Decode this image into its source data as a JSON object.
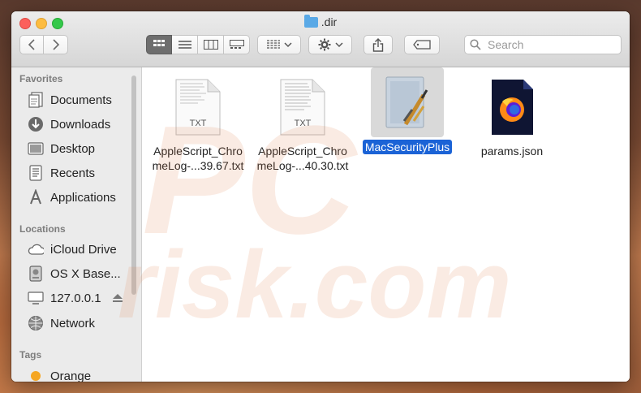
{
  "window": {
    "title": ".dir"
  },
  "toolbar": {
    "back_icon": "chevron-left-icon",
    "forward_icon": "chevron-right-icon",
    "view_modes": [
      "icon-view",
      "list-view",
      "column-view",
      "gallery-view"
    ],
    "active_view": "icon-view",
    "search_placeholder": "Search"
  },
  "sidebar": {
    "favorites_label": "Favorites",
    "favorites": [
      {
        "label": "Documents",
        "icon": "documents-icon"
      },
      {
        "label": "Downloads",
        "icon": "downloads-icon"
      },
      {
        "label": "Desktop",
        "icon": "desktop-icon"
      },
      {
        "label": "Recents",
        "icon": "recents-icon"
      },
      {
        "label": "Applications",
        "icon": "applications-icon"
      }
    ],
    "locations_label": "Locations",
    "locations": [
      {
        "label": "iCloud Drive",
        "icon": "cloud-icon"
      },
      {
        "label": "OS X Base...",
        "icon": "disk-icon"
      },
      {
        "label": "127.0.0.1",
        "icon": "computer-icon",
        "eject_icon": "eject-icon"
      },
      {
        "label": "Network",
        "icon": "network-icon"
      }
    ],
    "tags_label": "Tags",
    "tags": [
      {
        "label": "Orange",
        "color": "#f5a623"
      }
    ]
  },
  "files": [
    {
      "line1": "AppleScript_Chro",
      "line2": "meLog-...39.67.txt",
      "icon": "txt-document-icon",
      "badge": "TXT",
      "selected": false
    },
    {
      "line1": "AppleScript_Chro",
      "line2": "meLog-...40.30.txt",
      "icon": "txt-document-icon",
      "badge": "TXT",
      "selected": false
    },
    {
      "line1": "MacSecurityPlus",
      "icon": "app-icon",
      "selected": true
    },
    {
      "line1": "params.json",
      "icon": "firefox-document-icon",
      "selected": false
    }
  ],
  "watermark": {
    "line1": "PC",
    "line2": "risk.com"
  },
  "colors": {
    "selection": "#1b63d6",
    "sidebar_bg": "#ebebeb"
  }
}
